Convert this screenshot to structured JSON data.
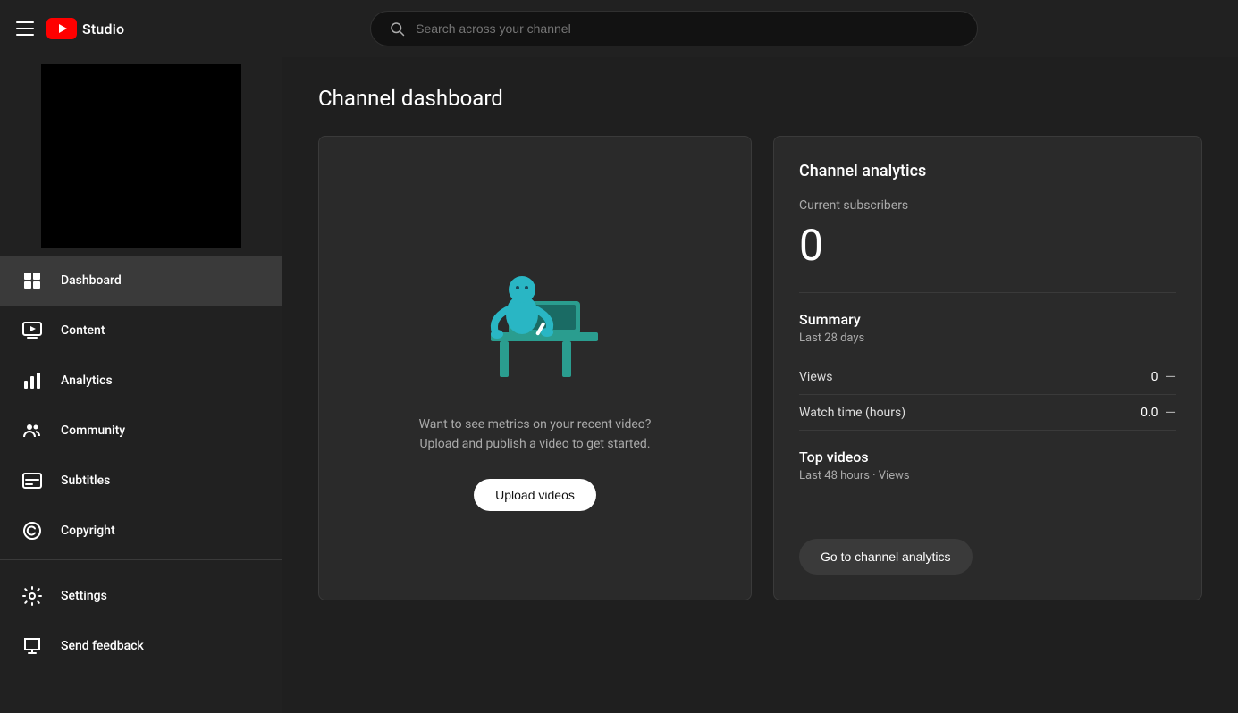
{
  "topbar": {
    "logo_alt": "YouTube Studio",
    "studio_label": "Studio",
    "search_placeholder": "Search across your channel"
  },
  "sidebar": {
    "items": [
      {
        "id": "dashboard",
        "label": "Dashboard",
        "active": true
      },
      {
        "id": "content",
        "label": "Content",
        "active": false
      },
      {
        "id": "analytics",
        "label": "Analytics",
        "active": false
      },
      {
        "id": "community",
        "label": "Community",
        "active": false
      },
      {
        "id": "subtitles",
        "label": "Subtitles",
        "active": false
      },
      {
        "id": "copyright",
        "label": "Copyright",
        "active": false
      }
    ],
    "bottom_items": [
      {
        "id": "settings",
        "label": "Settings"
      },
      {
        "id": "send-feedback",
        "label": "Send feedback"
      }
    ]
  },
  "main": {
    "page_title": "Channel dashboard",
    "video_card": {
      "message_line1": "Want to see metrics on your recent video?",
      "message_line2": "Upload and publish a video to get started.",
      "upload_btn_label": "Upload videos"
    },
    "analytics_card": {
      "title": "Channel analytics",
      "subscribers_label": "Current subscribers",
      "subscribers_count": "0",
      "summary_title": "Summary",
      "summary_period": "Last 28 days",
      "rows": [
        {
          "label": "Views",
          "value": "0",
          "change": "—"
        },
        {
          "label": "Watch time (hours)",
          "value": "0.0",
          "change": "—"
        }
      ],
      "top_videos_title": "Top videos",
      "top_videos_period": "Last 48 hours · Views",
      "go_to_analytics_label": "Go to channel analytics"
    }
  }
}
